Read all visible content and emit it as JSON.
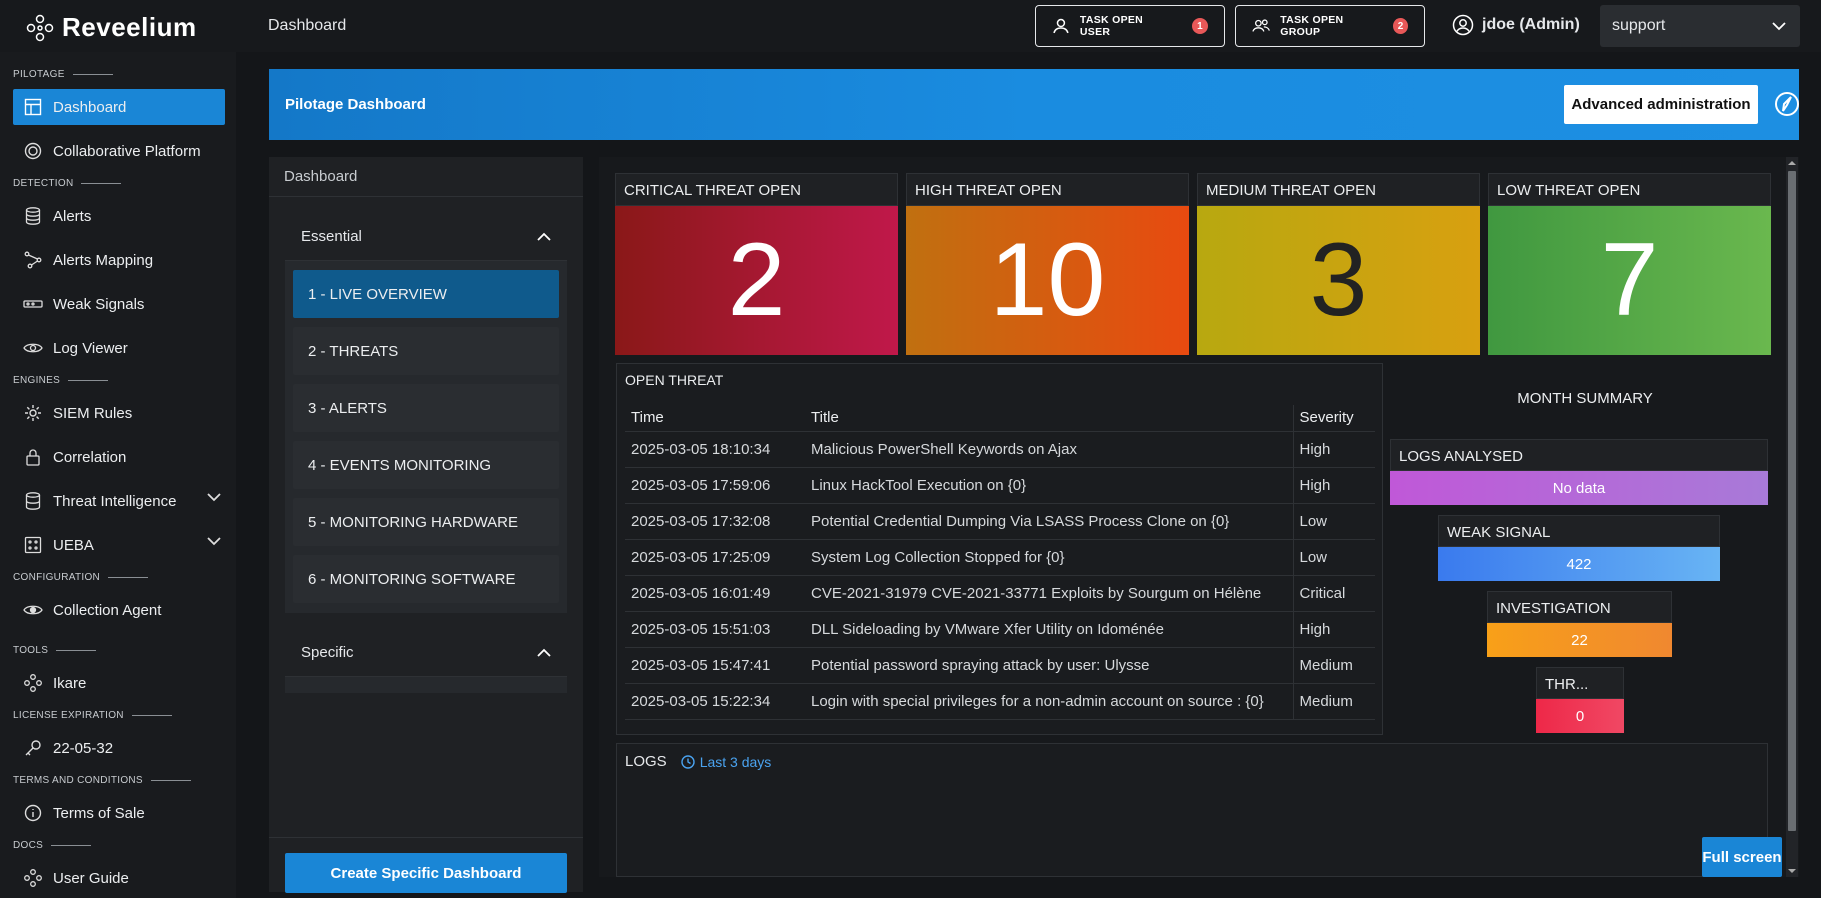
{
  "app": {
    "name": "Reveelium",
    "breadcrumb": "Dashboard"
  },
  "topbar": {
    "task_user": {
      "label": "TASK OPEN USER",
      "count": "1"
    },
    "task_group": {
      "label": "TASK OPEN GROUP",
      "count": "2"
    },
    "user": "jdoe (Admin)",
    "tenant_select": "support"
  },
  "sidebar": {
    "sections": {
      "pilotage": "PILOTAGE",
      "detection": "DETECTION",
      "engines": "ENGINES",
      "configuration": "CONFIGURATION",
      "tools": "TOOLS",
      "license": "LICENSE EXPIRATION",
      "terms": "TERMS AND CONDITIONS",
      "docs": "DOCS"
    },
    "items": {
      "dashboard": "Dashboard",
      "collab": "Collaborative Platform",
      "alerts": "Alerts",
      "alerts_mapping": "Alerts Mapping",
      "weak_signals": "Weak Signals",
      "log_viewer": "Log Viewer",
      "siem_rules": "SIEM Rules",
      "correlation": "Correlation",
      "threat_intel": "Threat Intelligence",
      "ueba": "UEBA",
      "collection_agent": "Collection Agent",
      "ikare": "Ikare",
      "license_date": "22-05-32",
      "terms_of_sale": "Terms of Sale",
      "user_guide": "User Guide"
    }
  },
  "banner": {
    "title": "Pilotage Dashboard",
    "advanced_button": "Advanced administration"
  },
  "dash_panel": {
    "header": "Dashboard",
    "essential": {
      "title": "Essential",
      "items": [
        "1 - LIVE OVERVIEW",
        "2 - THREATS",
        "3 - ALERTS",
        "4 - EVENTS MONITORING",
        "5 - MONITORING HARDWARE",
        "6 - MONITORING SOFTWARE"
      ]
    },
    "specific": {
      "title": "Specific"
    },
    "create_button": "Create Specific Dashboard"
  },
  "kpis": [
    {
      "label": "CRITICAL THREAT OPEN",
      "value": "2",
      "color": "#a81838"
    },
    {
      "label": "HIGH THREAT OPEN",
      "value": "10",
      "color": "#d85a10"
    },
    {
      "label": "MEDIUM THREAT OPEN",
      "value": "3",
      "color": "#c8a810"
    },
    {
      "label": "LOW THREAT OPEN",
      "value": "7",
      "color": "#58a848"
    }
  ],
  "open_threat": {
    "title": "OPEN THREAT",
    "columns": [
      "Time",
      "Title",
      "Severity"
    ],
    "rows": [
      [
        "2025-03-05 18:10:34",
        "Malicious PowerShell Keywords on Ajax",
        "High"
      ],
      [
        "2025-03-05 17:59:06",
        "Linux HackTool Execution on {0}",
        "High"
      ],
      [
        "2025-03-05 17:32:08",
        "Potential Credential Dumping Via LSASS Process Clone on {0}",
        "Low"
      ],
      [
        "2025-03-05 17:25:09",
        "System Log Collection Stopped for {0}",
        "Low"
      ],
      [
        "2025-03-05 16:01:49",
        "CVE-2021-31979 CVE-2021-33771 Exploits by Sourgum on Hélène",
        "Critical"
      ],
      [
        "2025-03-05 15:51:03",
        "DLL Sideloading by VMware Xfer Utility on Idoménée",
        "High"
      ],
      [
        "2025-03-05 15:47:41",
        "Potential password spraying attack by user: Ulysse",
        "Medium"
      ],
      [
        "2025-03-05 15:22:34",
        "Login with special privileges for a non-admin account on source : {0}",
        "Medium"
      ]
    ]
  },
  "month_summary": {
    "title": "MONTH SUMMARY",
    "logs_analysed": {
      "label": "LOGS ANALYSED",
      "value": "No data"
    },
    "weak_signal": {
      "label": "WEAK SIGNAL",
      "value": "422"
    },
    "investigation": {
      "label": "INVESTIGATION",
      "value": "22"
    },
    "threat": {
      "label": "THR...",
      "value": "0"
    }
  },
  "logs": {
    "title": "LOGS",
    "range": "Last 3 days"
  },
  "fullscreen_button": "Full screen"
}
